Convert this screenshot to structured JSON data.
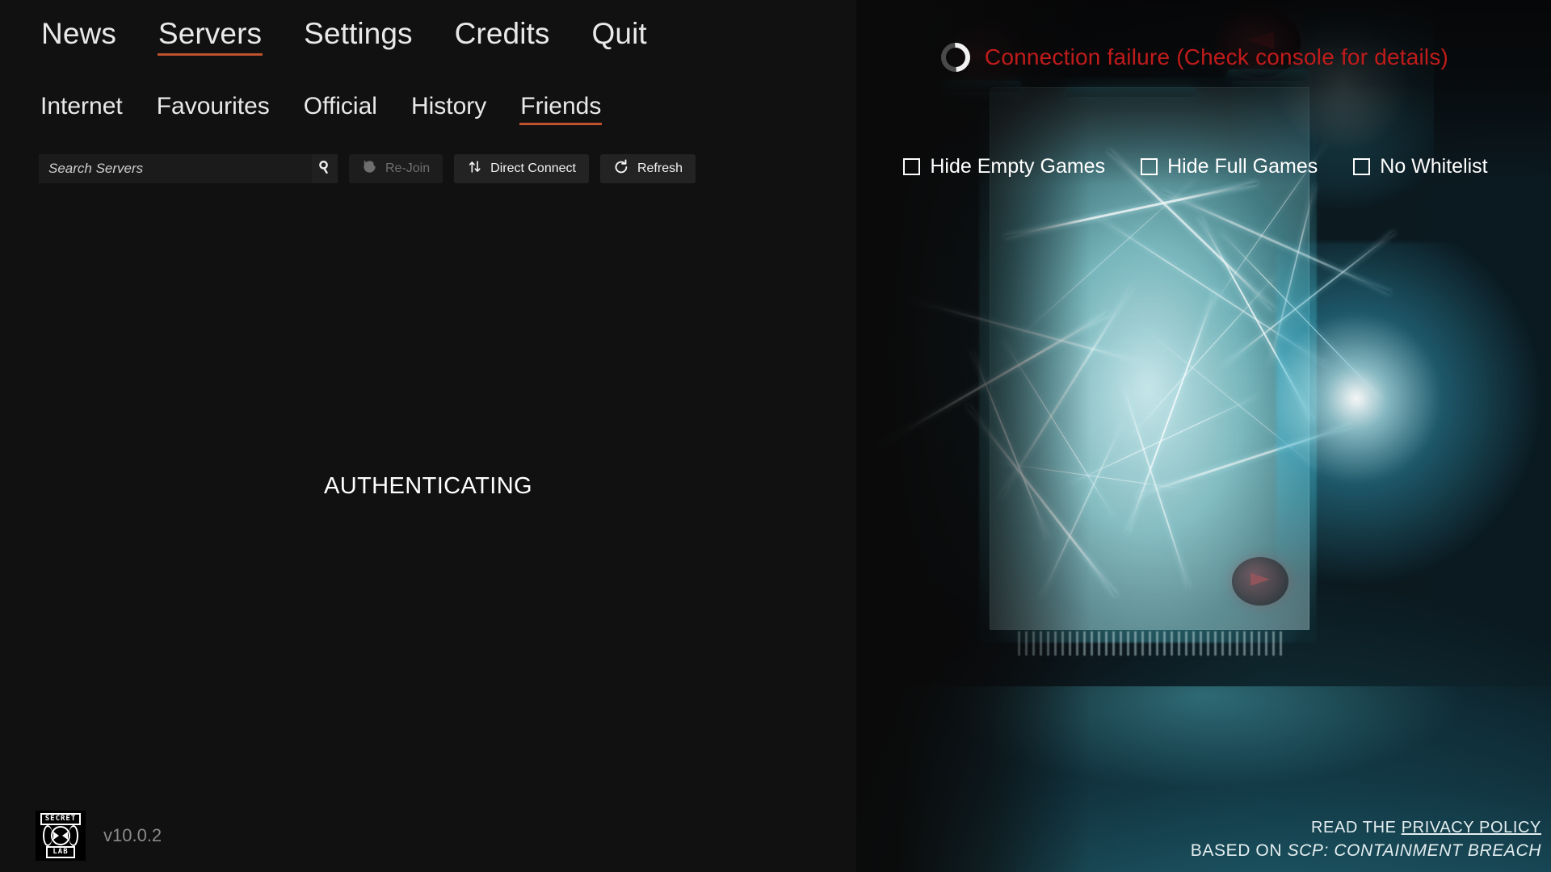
{
  "app": {
    "version": "v10.0.2",
    "logo_top": "SECRET",
    "logo_bottom": "LAB",
    "accent_color": "#c0522c",
    "error_color": "#c01b1b"
  },
  "main_nav": {
    "items": [
      {
        "label": "News",
        "active": false
      },
      {
        "label": "Servers",
        "active": true
      },
      {
        "label": "Settings",
        "active": false
      },
      {
        "label": "Credits",
        "active": false
      },
      {
        "label": "Quit",
        "active": false
      }
    ]
  },
  "sub_nav": {
    "items": [
      {
        "label": "Internet",
        "active": false
      },
      {
        "label": "Favourites",
        "active": false
      },
      {
        "label": "Official",
        "active": false
      },
      {
        "label": "History",
        "active": false
      },
      {
        "label": "Friends",
        "active": true
      }
    ]
  },
  "toolbar": {
    "search_placeholder": "Search Servers",
    "search_value": "",
    "search_icon": "magnifier-icon",
    "buttons": [
      {
        "label": "Re-Join",
        "icon": "history-rewind-icon",
        "disabled": true
      },
      {
        "label": "Direct Connect",
        "icon": "up-down-arrows-icon",
        "disabled": false
      },
      {
        "label": "Refresh",
        "icon": "refresh-icon",
        "disabled": false
      }
    ]
  },
  "server_list": {
    "status_text": "AUTHENTICATING"
  },
  "connection": {
    "spinner_icon": "loading-spinner-icon",
    "message": "Connection failure (Check console for details)"
  },
  "filters": {
    "items": [
      {
        "label": "Hide Empty Games",
        "checked": false
      },
      {
        "label": "Hide Full Games",
        "checked": false
      },
      {
        "label": "No Whitelist",
        "checked": false
      }
    ]
  },
  "legal": {
    "read_the": "READ THE",
    "privacy_policy": "PRIVACY POLICY",
    "based_on_prefix": "BASED ON",
    "based_on_title": "SCP: CONTAINMENT BREACH"
  }
}
